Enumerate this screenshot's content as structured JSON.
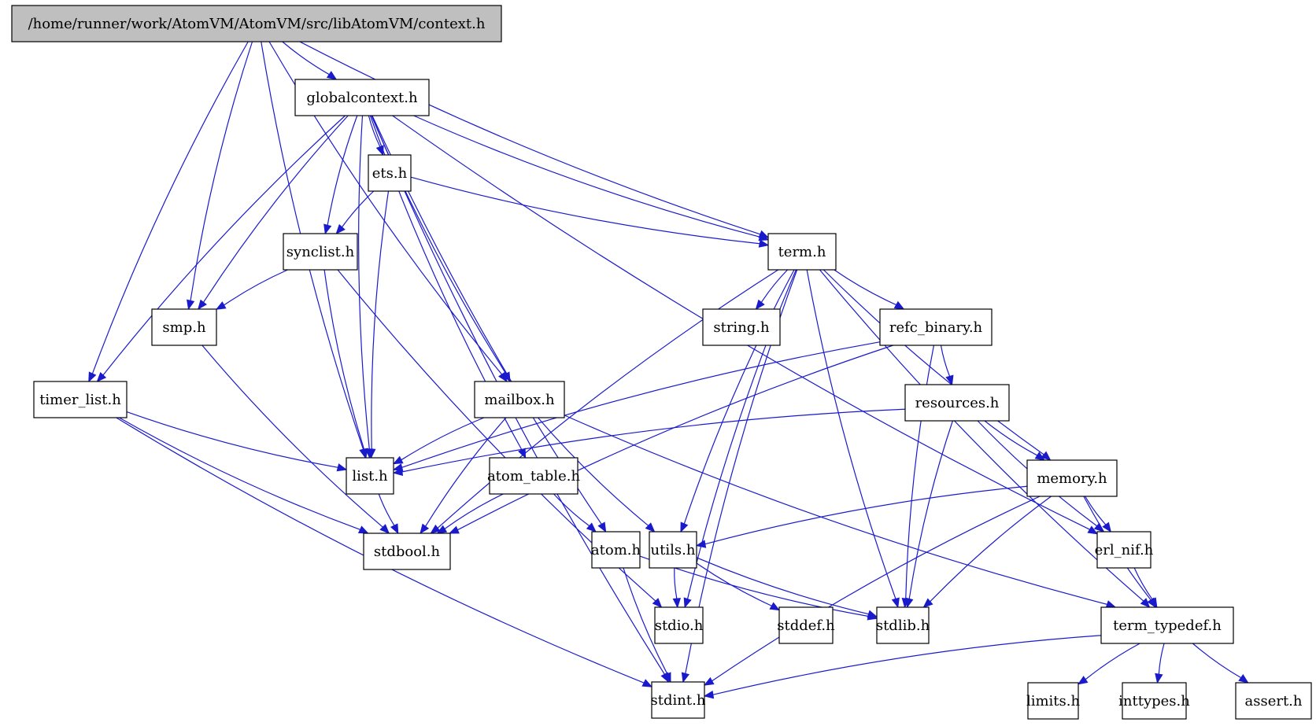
{
  "title": "/home/runner/work/AtomVM/AtomVM/src/libAtomVM/context.h",
  "colors": {
    "edge": "#1a1acd",
    "root_fill": "#bfbfbf",
    "node_fill": "#ffffff",
    "border": "#000000"
  },
  "nodes": [
    {
      "id": "context",
      "label": "/home/runner/work/AtomVM/AtomVM/src/libAtomVM/context.h",
      "root": true
    },
    {
      "id": "globalcontext",
      "label": "globalcontext.h"
    },
    {
      "id": "ets",
      "label": "ets.h"
    },
    {
      "id": "synclist",
      "label": "synclist.h"
    },
    {
      "id": "term",
      "label": "term.h"
    },
    {
      "id": "smp",
      "label": "smp.h"
    },
    {
      "id": "string",
      "label": "string.h"
    },
    {
      "id": "refc_binary",
      "label": "refc_binary.h"
    },
    {
      "id": "timer_list",
      "label": "timer_list.h"
    },
    {
      "id": "mailbox",
      "label": "mailbox.h"
    },
    {
      "id": "resources",
      "label": "resources.h"
    },
    {
      "id": "list",
      "label": "list.h"
    },
    {
      "id": "atom_table",
      "label": "atom_table.h"
    },
    {
      "id": "memory",
      "label": "memory.h"
    },
    {
      "id": "stdbool",
      "label": "stdbool.h"
    },
    {
      "id": "atom",
      "label": "atom.h"
    },
    {
      "id": "utils",
      "label": "utils.h"
    },
    {
      "id": "erl_nif",
      "label": "erl_nif.h"
    },
    {
      "id": "stdio",
      "label": "stdio.h"
    },
    {
      "id": "stddef",
      "label": "stddef.h"
    },
    {
      "id": "stdlib",
      "label": "stdlib.h"
    },
    {
      "id": "term_typedef",
      "label": "term_typedef.h"
    },
    {
      "id": "stdint",
      "label": "stdint.h"
    },
    {
      "id": "limits",
      "label": "limits.h"
    },
    {
      "id": "inttypes",
      "label": "inttypes.h"
    },
    {
      "id": "assert",
      "label": "assert.h"
    }
  ],
  "edges": [
    [
      "context",
      "globalcontext"
    ],
    [
      "context",
      "term"
    ],
    [
      "context",
      "timer_list"
    ],
    [
      "context",
      "list"
    ],
    [
      "context",
      "smp"
    ],
    [
      "context",
      "mailbox"
    ],
    [
      "globalcontext",
      "ets"
    ],
    [
      "globalcontext",
      "synclist"
    ],
    [
      "globalcontext",
      "term"
    ],
    [
      "globalcontext",
      "smp"
    ],
    [
      "globalcontext",
      "timer_list"
    ],
    [
      "globalcontext",
      "list"
    ],
    [
      "globalcontext",
      "mailbox"
    ],
    [
      "globalcontext",
      "atom_table"
    ],
    [
      "globalcontext",
      "atom"
    ],
    [
      "globalcontext",
      "erl_nif"
    ],
    [
      "globalcontext",
      "stdint"
    ],
    [
      "ets",
      "synclist"
    ],
    [
      "ets",
      "term"
    ],
    [
      "ets",
      "list"
    ],
    [
      "synclist",
      "smp"
    ],
    [
      "synclist",
      "list"
    ],
    [
      "synclist",
      "stdio"
    ],
    [
      "smp",
      "stdbool"
    ],
    [
      "term",
      "string"
    ],
    [
      "term",
      "refc_binary"
    ],
    [
      "term",
      "memory"
    ],
    [
      "term",
      "utils"
    ],
    [
      "term",
      "stdio"
    ],
    [
      "term",
      "stdlib"
    ],
    [
      "term",
      "stdint"
    ],
    [
      "term",
      "stdbool"
    ],
    [
      "term",
      "term_typedef"
    ],
    [
      "refc_binary",
      "resources"
    ],
    [
      "refc_binary",
      "list"
    ],
    [
      "refc_binary",
      "stdbool"
    ],
    [
      "refc_binary",
      "stdlib"
    ],
    [
      "resources",
      "memory"
    ],
    [
      "resources",
      "list"
    ],
    [
      "resources",
      "erl_nif"
    ],
    [
      "resources",
      "stdlib"
    ],
    [
      "timer_list",
      "list"
    ],
    [
      "timer_list",
      "stdbool"
    ],
    [
      "timer_list",
      "stdint"
    ],
    [
      "mailbox",
      "list"
    ],
    [
      "mailbox",
      "stdbool"
    ],
    [
      "mailbox",
      "utils"
    ],
    [
      "mailbox",
      "term_typedef"
    ],
    [
      "list",
      "stdbool"
    ],
    [
      "atom_table",
      "stdbool"
    ],
    [
      "atom_table",
      "atom"
    ],
    [
      "atom",
      "stdlib"
    ],
    [
      "atom",
      "stdint"
    ],
    [
      "memory",
      "utils"
    ],
    [
      "memory",
      "erl_nif"
    ],
    [
      "memory",
      "stdlib"
    ],
    [
      "memory",
      "stdint"
    ],
    [
      "memory",
      "term_typedef"
    ],
    [
      "utils",
      "stdio"
    ],
    [
      "utils",
      "stddef"
    ],
    [
      "utils",
      "stdlib"
    ],
    [
      "erl_nif",
      "term_typedef"
    ],
    [
      "term_typedef",
      "stdint"
    ],
    [
      "term_typedef",
      "limits"
    ],
    [
      "term_typedef",
      "inttypes"
    ],
    [
      "term_typedef",
      "assert"
    ]
  ]
}
